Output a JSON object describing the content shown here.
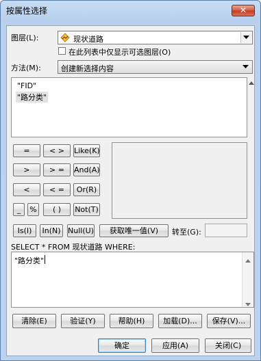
{
  "window": {
    "title": "按属性选择",
    "close_label": "✕"
  },
  "layer": {
    "label": "图层(L):",
    "value": "现状道路",
    "icon": "line-layer-icon",
    "only_selectable_label": "在此列表中仅显示可选图层(O)",
    "only_selectable_checked": false
  },
  "method": {
    "label": "方法(M):",
    "value": "创建新选择内容"
  },
  "fields": {
    "items": [
      "\"FID\"",
      "\"路分类\""
    ],
    "selected": "\"路分类\""
  },
  "operators": {
    "eq": "=",
    "neq": "< >",
    "like": "Like(K)",
    "gt": ">",
    "gte": "> =",
    "and": "And(A)",
    "lt": "<",
    "lte": "< =",
    "or": "Or(R)",
    "underscore": "_",
    "percent": "%",
    "parens": "( )",
    "not": "Not(T)",
    "is": "Is(I)",
    "in": "In(N)",
    "null": "Null(U)"
  },
  "unique_values_button": "获取唯一值(V)",
  "goto_label": "转至(G):",
  "goto_value": "",
  "where_label": "SELECT * FROM 现状道路 WHERE:",
  "where_text": "\"路分类\"",
  "actions": {
    "clear": "清除(E)",
    "verify": "验证(Y)",
    "help": "帮助(H)",
    "load": "加载(D)...",
    "save": "保存(V)..."
  },
  "footer": {
    "ok": "确定",
    "apply": "应用(A)",
    "close": "关闭(C)"
  }
}
